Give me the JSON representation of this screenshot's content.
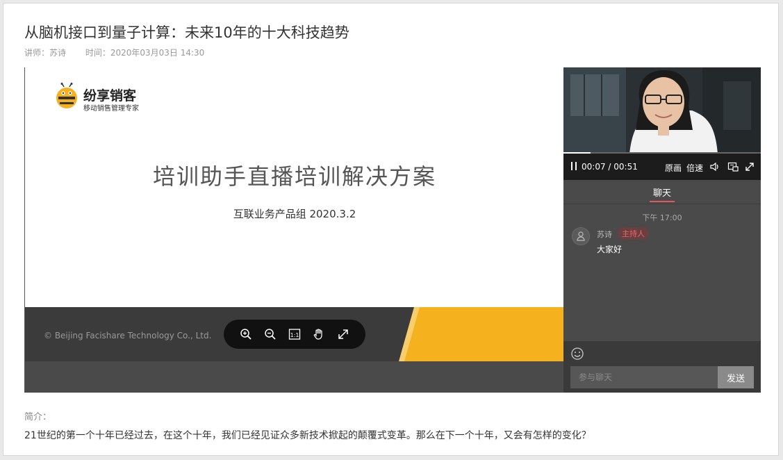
{
  "page": {
    "title": "从脑机接口到量子计算：未来10年的十大科技趋势",
    "lecturer": "讲师：苏诗",
    "time": "时间：2020年03月03日 14:30"
  },
  "slide": {
    "brand": "纷享销客",
    "brand_tagline": "移动销售管理专家",
    "title": "培训助手直播培训解决方案",
    "subtitle": "互联业务产品组  2020.3.2",
    "copyright": "© Beijing Facishare Technology Co., Ltd.",
    "accent_color": "#f5b21e",
    "footer_color": "#3b3b3b"
  },
  "zoom_toolbar": {
    "icons": [
      "zoom-in-icon",
      "zoom-out-icon",
      "actual-size-icon",
      "hand-icon",
      "fullscreen-icon"
    ],
    "actual_size_label": "1:1"
  },
  "video": {
    "current_time": "00:07",
    "duration": "00:51",
    "time_display": "00:07 / 00:51",
    "progress_fraction": 0.137,
    "quality_label": "原画",
    "speed_label": "倍速"
  },
  "chat": {
    "tab_label": "聊天",
    "timestamp": "下午 17:00",
    "messages": [
      {
        "name": "苏诗",
        "role": "主持人",
        "text": "大家好"
      }
    ],
    "input_placeholder": "参与聊天",
    "send_label": "发送"
  },
  "intro": {
    "label": "简介：",
    "text": "21世纪的第一个十年已经过去，在这个十年，我们已经见证众多新技术掀起的颠覆式变革。那么在下一个十年，又会有怎样的变化？"
  }
}
